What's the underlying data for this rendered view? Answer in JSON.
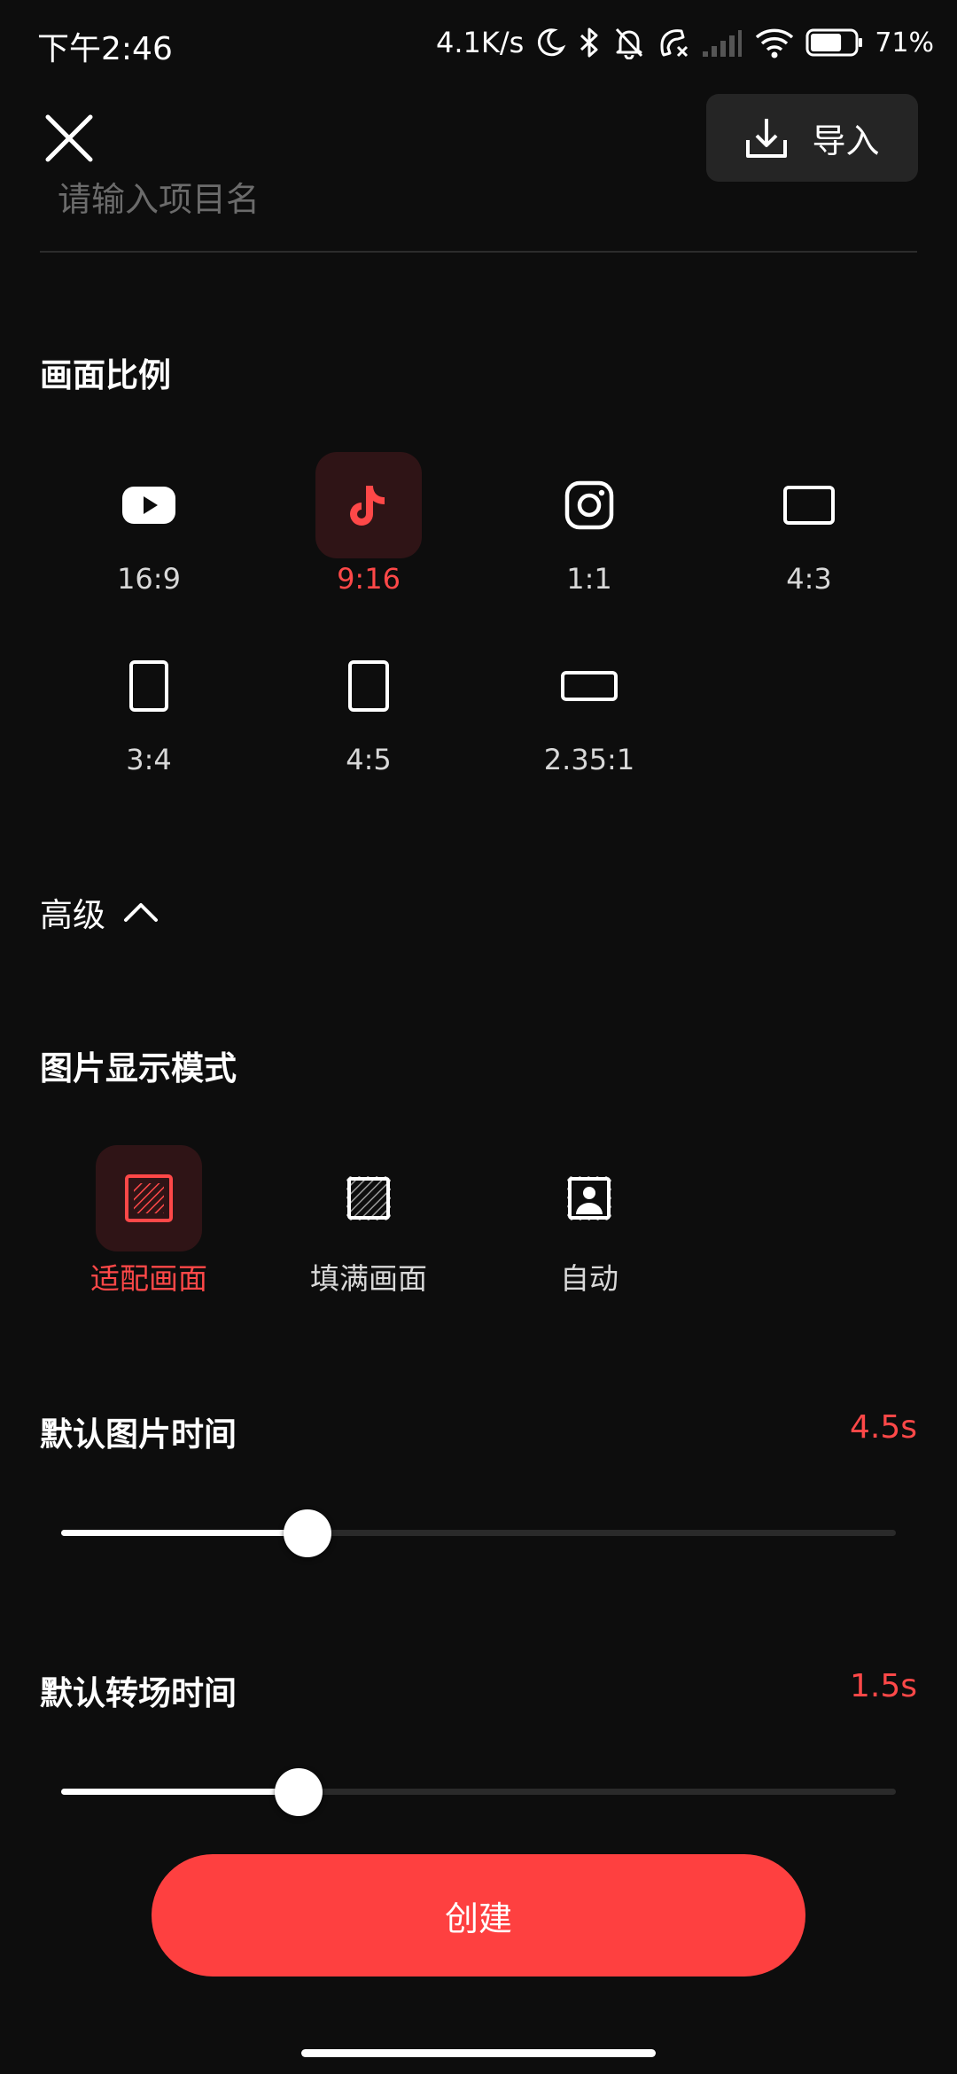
{
  "status_bar": {
    "time": "下午2:46",
    "network_speed": "4.1K/s",
    "battery_percent": "71%",
    "battery_level": 0.71
  },
  "header": {
    "import_label": "导入"
  },
  "project_name": {
    "value": "",
    "placeholder": "请输入项目名"
  },
  "aspect_ratio": {
    "title": "画面比例",
    "options": [
      {
        "label": "16:9",
        "icon": "youtube-icon",
        "selected": false
      },
      {
        "label": "9:16",
        "icon": "tiktok-icon",
        "selected": true
      },
      {
        "label": "1:1",
        "icon": "instagram-icon",
        "selected": false
      },
      {
        "label": "4:3",
        "icon": "landscape-rect-icon",
        "selected": false
      },
      {
        "label": "3:4",
        "icon": "portrait-rect-icon",
        "selected": false
      },
      {
        "label": "4:5",
        "icon": "portrait-rect-icon",
        "selected": false
      },
      {
        "label": "2.35:1",
        "icon": "wide-rect-icon",
        "selected": false
      }
    ]
  },
  "advanced": {
    "label": "高级",
    "expanded": true
  },
  "image_mode": {
    "title": "图片显示模式",
    "options": [
      {
        "label": "适配画面",
        "icon": "fit-frame-icon",
        "selected": true
      },
      {
        "label": "填满画面",
        "icon": "fill-frame-icon",
        "selected": false
      },
      {
        "label": "自动",
        "icon": "auto-portrait-icon",
        "selected": false
      }
    ]
  },
  "image_duration": {
    "title": "默认图片时间",
    "value_text": "4.5s",
    "level": 0.295
  },
  "transition_duration": {
    "title": "默认转场时间",
    "value_text": "1.5s",
    "level": 0.285
  },
  "create_button": {
    "label": "创建"
  },
  "colors": {
    "background": "#0d0d0d",
    "accent": "#fe4848",
    "selected_bg": "#2f1416",
    "button": "#fe4040"
  }
}
